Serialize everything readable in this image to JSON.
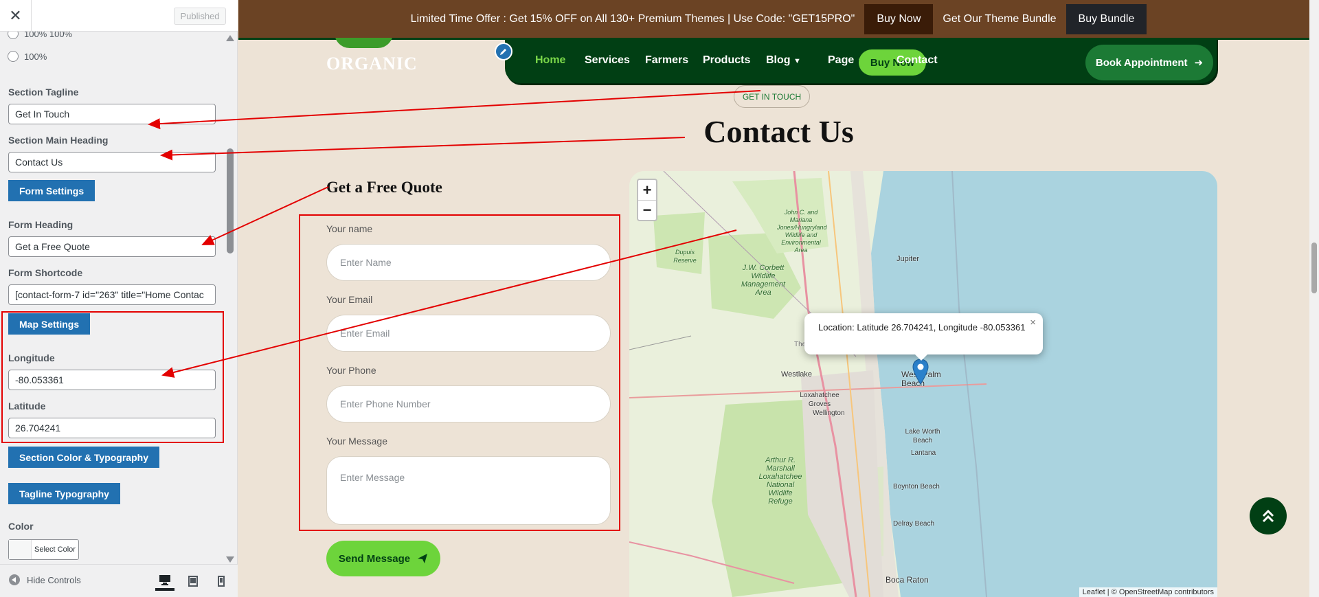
{
  "sidebar": {
    "published_label": "Published",
    "radio_options": [
      "100% 100%",
      "100%"
    ],
    "fields": {
      "tagline": {
        "label": "Section Tagline",
        "value": "Get In Touch"
      },
      "main_heading": {
        "label": "Section Main Heading",
        "value": "Contact Us"
      },
      "form_heading": {
        "label": "Form Heading",
        "value": "Get a Free Quote"
      },
      "form_shortcode": {
        "label": "Form Shortcode",
        "value": "[contact-form-7 id=\"263\" title=\"Home Contac"
      },
      "longitude": {
        "label": "Longitude",
        "value": "-80.053361"
      },
      "latitude": {
        "label": "Latitude",
        "value": "26.704241"
      },
      "color": {
        "label": "Color",
        "button": "Select Color"
      }
    },
    "buttons": {
      "form_settings": "Form Settings",
      "map_settings": "Map Settings",
      "section_color": "Section Color & Typography",
      "tagline_typography": "Tagline Typography"
    },
    "footer": {
      "hide_controls": "Hide Controls"
    }
  },
  "promo": {
    "text": "Limited Time Offer : Get 15% OFF on All 130+ Premium Themes | Use Code: \"GET15PRO\"",
    "buy_now": "Buy Now",
    "bundle_text": "Get Our Theme Bundle",
    "buy_bundle": "Buy Bundle"
  },
  "logo": {
    "text": "ORGANIC"
  },
  "nav": {
    "items": [
      "Home",
      "Services",
      "Farmers",
      "Products",
      "Blog",
      "Page",
      "Contact"
    ],
    "buy_now": "Buy Now",
    "book": "Book Appointment"
  },
  "section": {
    "tagline": "GET IN TOUCH",
    "heading": "Contact Us"
  },
  "form": {
    "heading": "Get a Free Quote",
    "fields": [
      {
        "label": "Your name",
        "placeholder": "Enter Name"
      },
      {
        "label": "Your Email",
        "placeholder": "Enter Email"
      },
      {
        "label": "Your Phone",
        "placeholder": "Enter Phone Number"
      },
      {
        "label": "Your Message",
        "placeholder": "Enter Message"
      }
    ],
    "submit": "Send Message"
  },
  "map": {
    "popup": "Location: Latitude 26.704241, Longitude -80.053361",
    "zoom_in": "+",
    "zoom_out": "−",
    "attribution": "Leaflet | © OpenStreetMap contributors",
    "places": {
      "jupiter": "Jupiter",
      "wpb": "West Palm Beach",
      "westlake": "Westlake",
      "loxahatchee": "Loxahatchee Groves",
      "wellington": "Wellington",
      "lake_worth": "Lake Worth Beach",
      "lantana": "Lantana",
      "boynton": "Boynton Beach",
      "delray": "Delray Beach",
      "boca": "Boca Raton",
      "dupuis": "Dupuis Reserve",
      "john_c": "John C. and Mariana Jones/Hungryland Wildlife and Environmental Area",
      "corbett": "J.W. Corbett Wildlife Management Area",
      "marshall": "Arthur R. Marshall Loxahatchee National Wildlife Refuge",
      "the": "The"
    }
  },
  "colors": {
    "accent_blue": "#2271b1",
    "promo_bg": "#6b4324",
    "nav_green": "#013f14",
    "light_green": "#6dd43b",
    "annotation_red": "#e30000"
  }
}
